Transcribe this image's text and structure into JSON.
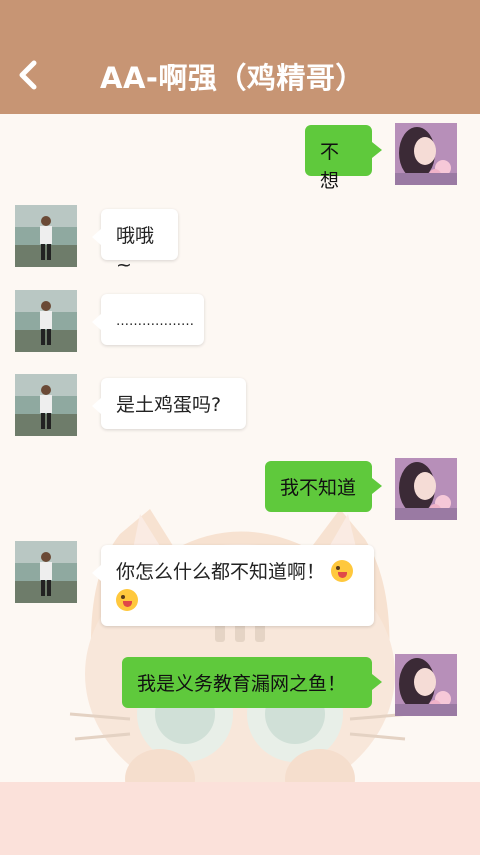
{
  "header": {
    "title": "AA-啊强（鸡精哥）",
    "back_icon": "chevron-left-icon",
    "bg_color": "#c79574"
  },
  "colors": {
    "sent_bubble": "#5fc93c",
    "received_bubble": "#ffffff",
    "chat_bg": "#fdf8f3"
  },
  "messages": [
    {
      "from": "me",
      "text": "不想"
    },
    {
      "from": "contact",
      "text": "哦哦~"
    },
    {
      "from": "contact",
      "text": "………………"
    },
    {
      "from": "contact",
      "text": "是土鸡蛋吗?"
    },
    {
      "from": "me",
      "text": "我不知道"
    },
    {
      "from": "contact",
      "text_line1": "你怎么什么都不知道啊！",
      "text_line2": "",
      "emoji": "winking-tongue-emoji"
    },
    {
      "from": "me",
      "text": "我是义务教育漏网之鱼！"
    }
  ]
}
